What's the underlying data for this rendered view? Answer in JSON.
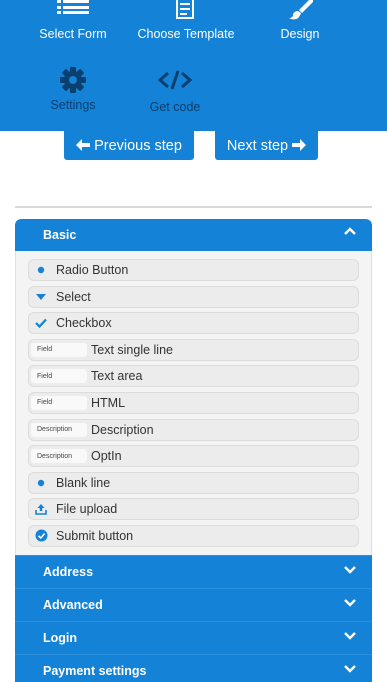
{
  "nav": {
    "items": [
      {
        "label": "Select Form",
        "icon": "list-icon"
      },
      {
        "label": "Choose Template",
        "icon": "document-icon"
      },
      {
        "label": "Design",
        "icon": "paintbrush-icon"
      },
      {
        "label": "Settings",
        "icon": "gear-icon"
      },
      {
        "label": "Get code",
        "icon": "code-icon"
      }
    ]
  },
  "steps": {
    "previous_arrow": "🠔",
    "previous_label": "Previous step",
    "next_label": "Next step",
    "next_arrow": "🠖"
  },
  "sections": {
    "basic": {
      "title": "Basic",
      "expanded": true,
      "fields": [
        {
          "label": "Radio Button",
          "icon": "dot-icon"
        },
        {
          "label": "Select",
          "icon": "caret-down-icon"
        },
        {
          "label": "Checkbox",
          "icon": "check-icon"
        },
        {
          "label": "Text single line",
          "tag": "Field"
        },
        {
          "label": "Text area",
          "tag": "Field"
        },
        {
          "label": "HTML",
          "tag": "Field"
        },
        {
          "label": "Description",
          "tag": "Description"
        },
        {
          "label": "OptIn",
          "tag": "Description"
        },
        {
          "label": "Blank line",
          "icon": "dot-icon"
        },
        {
          "label": "File upload",
          "icon": "upload-icon"
        },
        {
          "label": "Submit button",
          "icon": "check-circle-icon"
        }
      ]
    },
    "address": {
      "title": "Address"
    },
    "advanced": {
      "title": "Advanced"
    },
    "login": {
      "title": "Login"
    },
    "payment": {
      "title": "Payment settings"
    }
  },
  "colors": {
    "primary": "#1482d7",
    "muted_icon": "#0b3f6e",
    "field_bg": "#ececec"
  }
}
